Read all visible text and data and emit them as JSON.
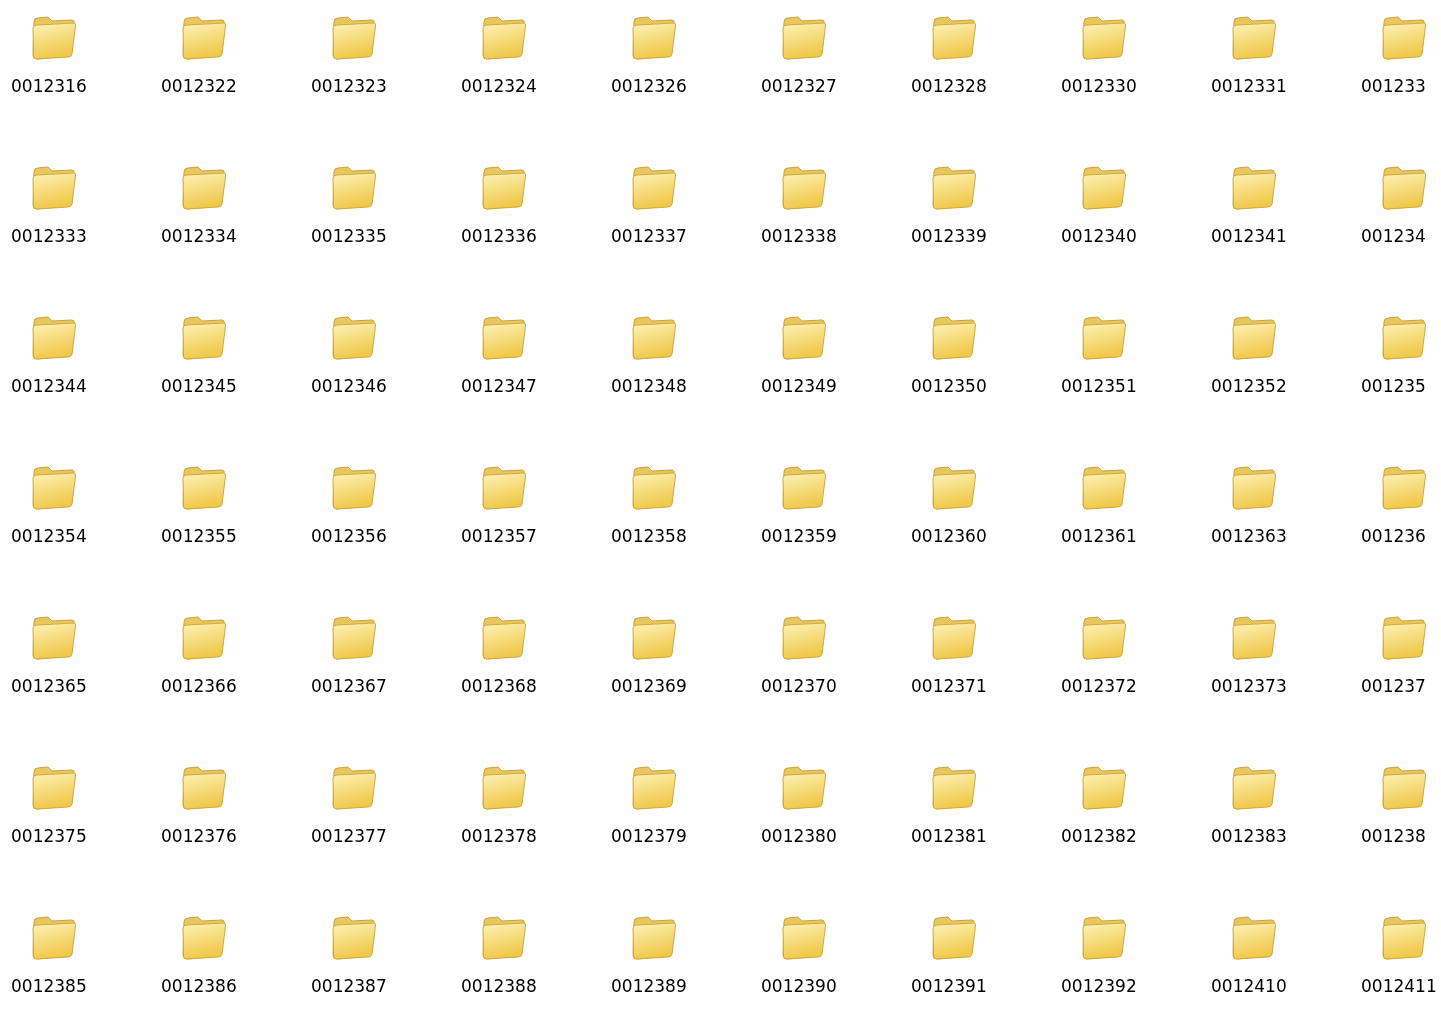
{
  "folders": [
    {
      "name": "0012316"
    },
    {
      "name": "0012322"
    },
    {
      "name": "0012323"
    },
    {
      "name": "0012324"
    },
    {
      "name": "0012326"
    },
    {
      "name": "0012327"
    },
    {
      "name": "0012328"
    },
    {
      "name": "0012330"
    },
    {
      "name": "0012331"
    },
    {
      "name": "001233"
    },
    {
      "name": "0012333"
    },
    {
      "name": "0012334"
    },
    {
      "name": "0012335"
    },
    {
      "name": "0012336"
    },
    {
      "name": "0012337"
    },
    {
      "name": "0012338"
    },
    {
      "name": "0012339"
    },
    {
      "name": "0012340"
    },
    {
      "name": "0012341"
    },
    {
      "name": "001234"
    },
    {
      "name": "0012344"
    },
    {
      "name": "0012345"
    },
    {
      "name": "0012346"
    },
    {
      "name": "0012347"
    },
    {
      "name": "0012348"
    },
    {
      "name": "0012349"
    },
    {
      "name": "0012350"
    },
    {
      "name": "0012351"
    },
    {
      "name": "0012352"
    },
    {
      "name": "001235"
    },
    {
      "name": "0012354"
    },
    {
      "name": "0012355"
    },
    {
      "name": "0012356"
    },
    {
      "name": "0012357"
    },
    {
      "name": "0012358"
    },
    {
      "name": "0012359"
    },
    {
      "name": "0012360"
    },
    {
      "name": "0012361"
    },
    {
      "name": "0012363"
    },
    {
      "name": "001236"
    },
    {
      "name": "0012365"
    },
    {
      "name": "0012366"
    },
    {
      "name": "0012367"
    },
    {
      "name": "0012368"
    },
    {
      "name": "0012369"
    },
    {
      "name": "0012370"
    },
    {
      "name": "0012371"
    },
    {
      "name": "0012372"
    },
    {
      "name": "0012373"
    },
    {
      "name": "001237"
    },
    {
      "name": "0012375"
    },
    {
      "name": "0012376"
    },
    {
      "name": "0012377"
    },
    {
      "name": "0012378"
    },
    {
      "name": "0012379"
    },
    {
      "name": "0012380"
    },
    {
      "name": "0012381"
    },
    {
      "name": "0012382"
    },
    {
      "name": "0012383"
    },
    {
      "name": "001238"
    },
    {
      "name": "0012385"
    },
    {
      "name": "0012386"
    },
    {
      "name": "0012387"
    },
    {
      "name": "0012388"
    },
    {
      "name": "0012389"
    },
    {
      "name": "0012390"
    },
    {
      "name": "0012391"
    },
    {
      "name": "0012392"
    },
    {
      "name": "0012410"
    },
    {
      "name": "0012411"
    }
  ]
}
